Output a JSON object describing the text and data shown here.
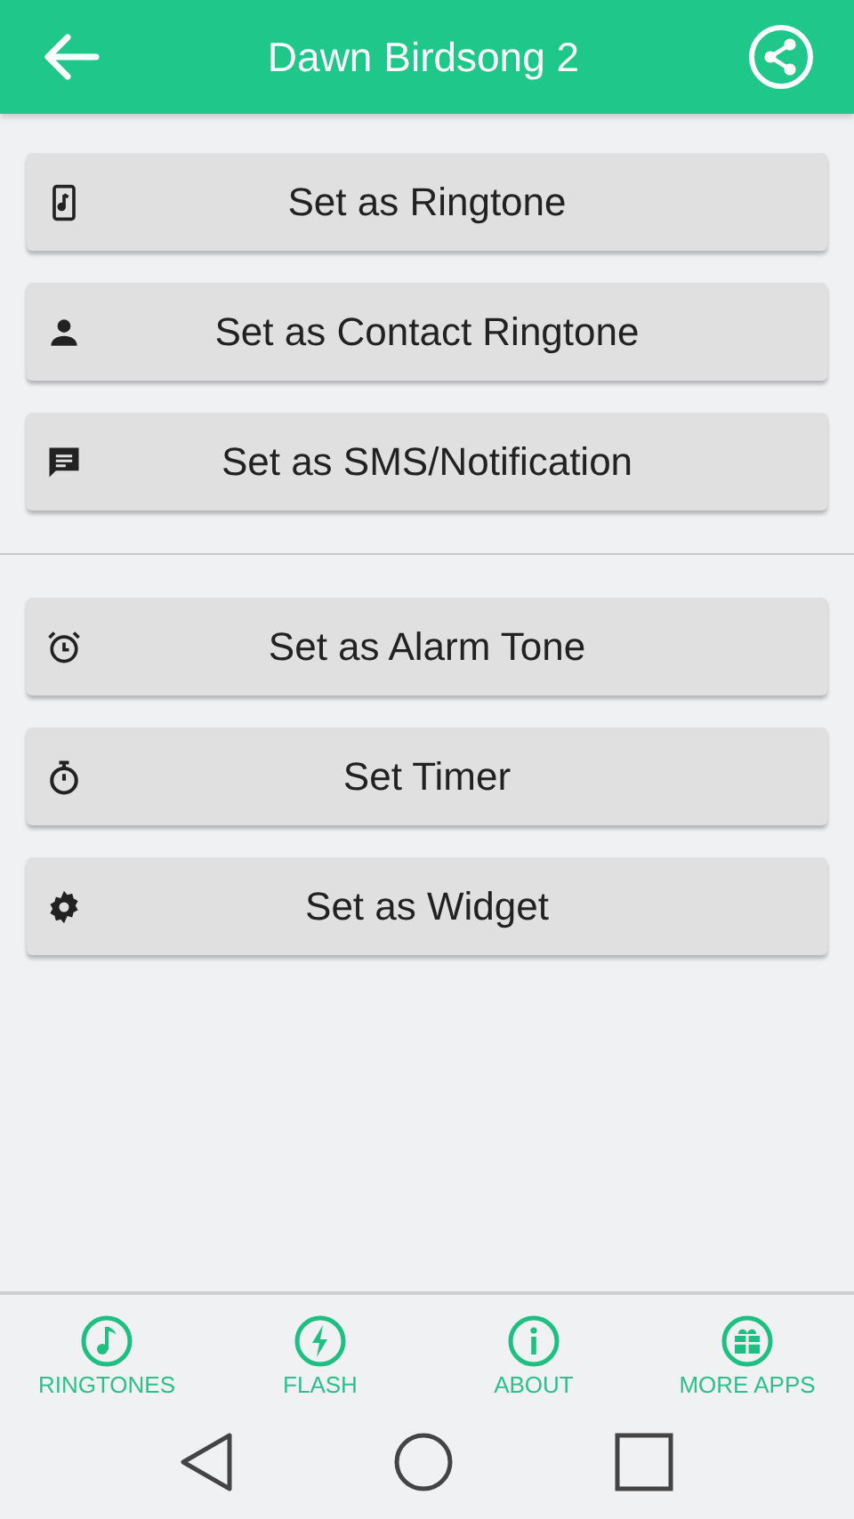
{
  "app_bar": {
    "title": "Dawn Birdsong 2"
  },
  "action_groups": [
    [
      {
        "kind": "ringtone",
        "label": "Set as Ringtone"
      },
      {
        "kind": "contact",
        "label": "Set as Contact Ringtone"
      },
      {
        "kind": "sms",
        "label": "Set as SMS/Notification"
      }
    ],
    [
      {
        "kind": "alarm",
        "label": "Set as Alarm Tone"
      },
      {
        "kind": "timer",
        "label": "Set Timer"
      },
      {
        "kind": "widget",
        "label": "Set as Widget"
      }
    ]
  ],
  "bottom_nav": [
    {
      "kind": "note",
      "label": "RINGTONES"
    },
    {
      "kind": "flash",
      "label": "FLASH"
    },
    {
      "kind": "info",
      "label": "ABOUT"
    },
    {
      "kind": "gift",
      "label": "MORE APPS"
    }
  ]
}
